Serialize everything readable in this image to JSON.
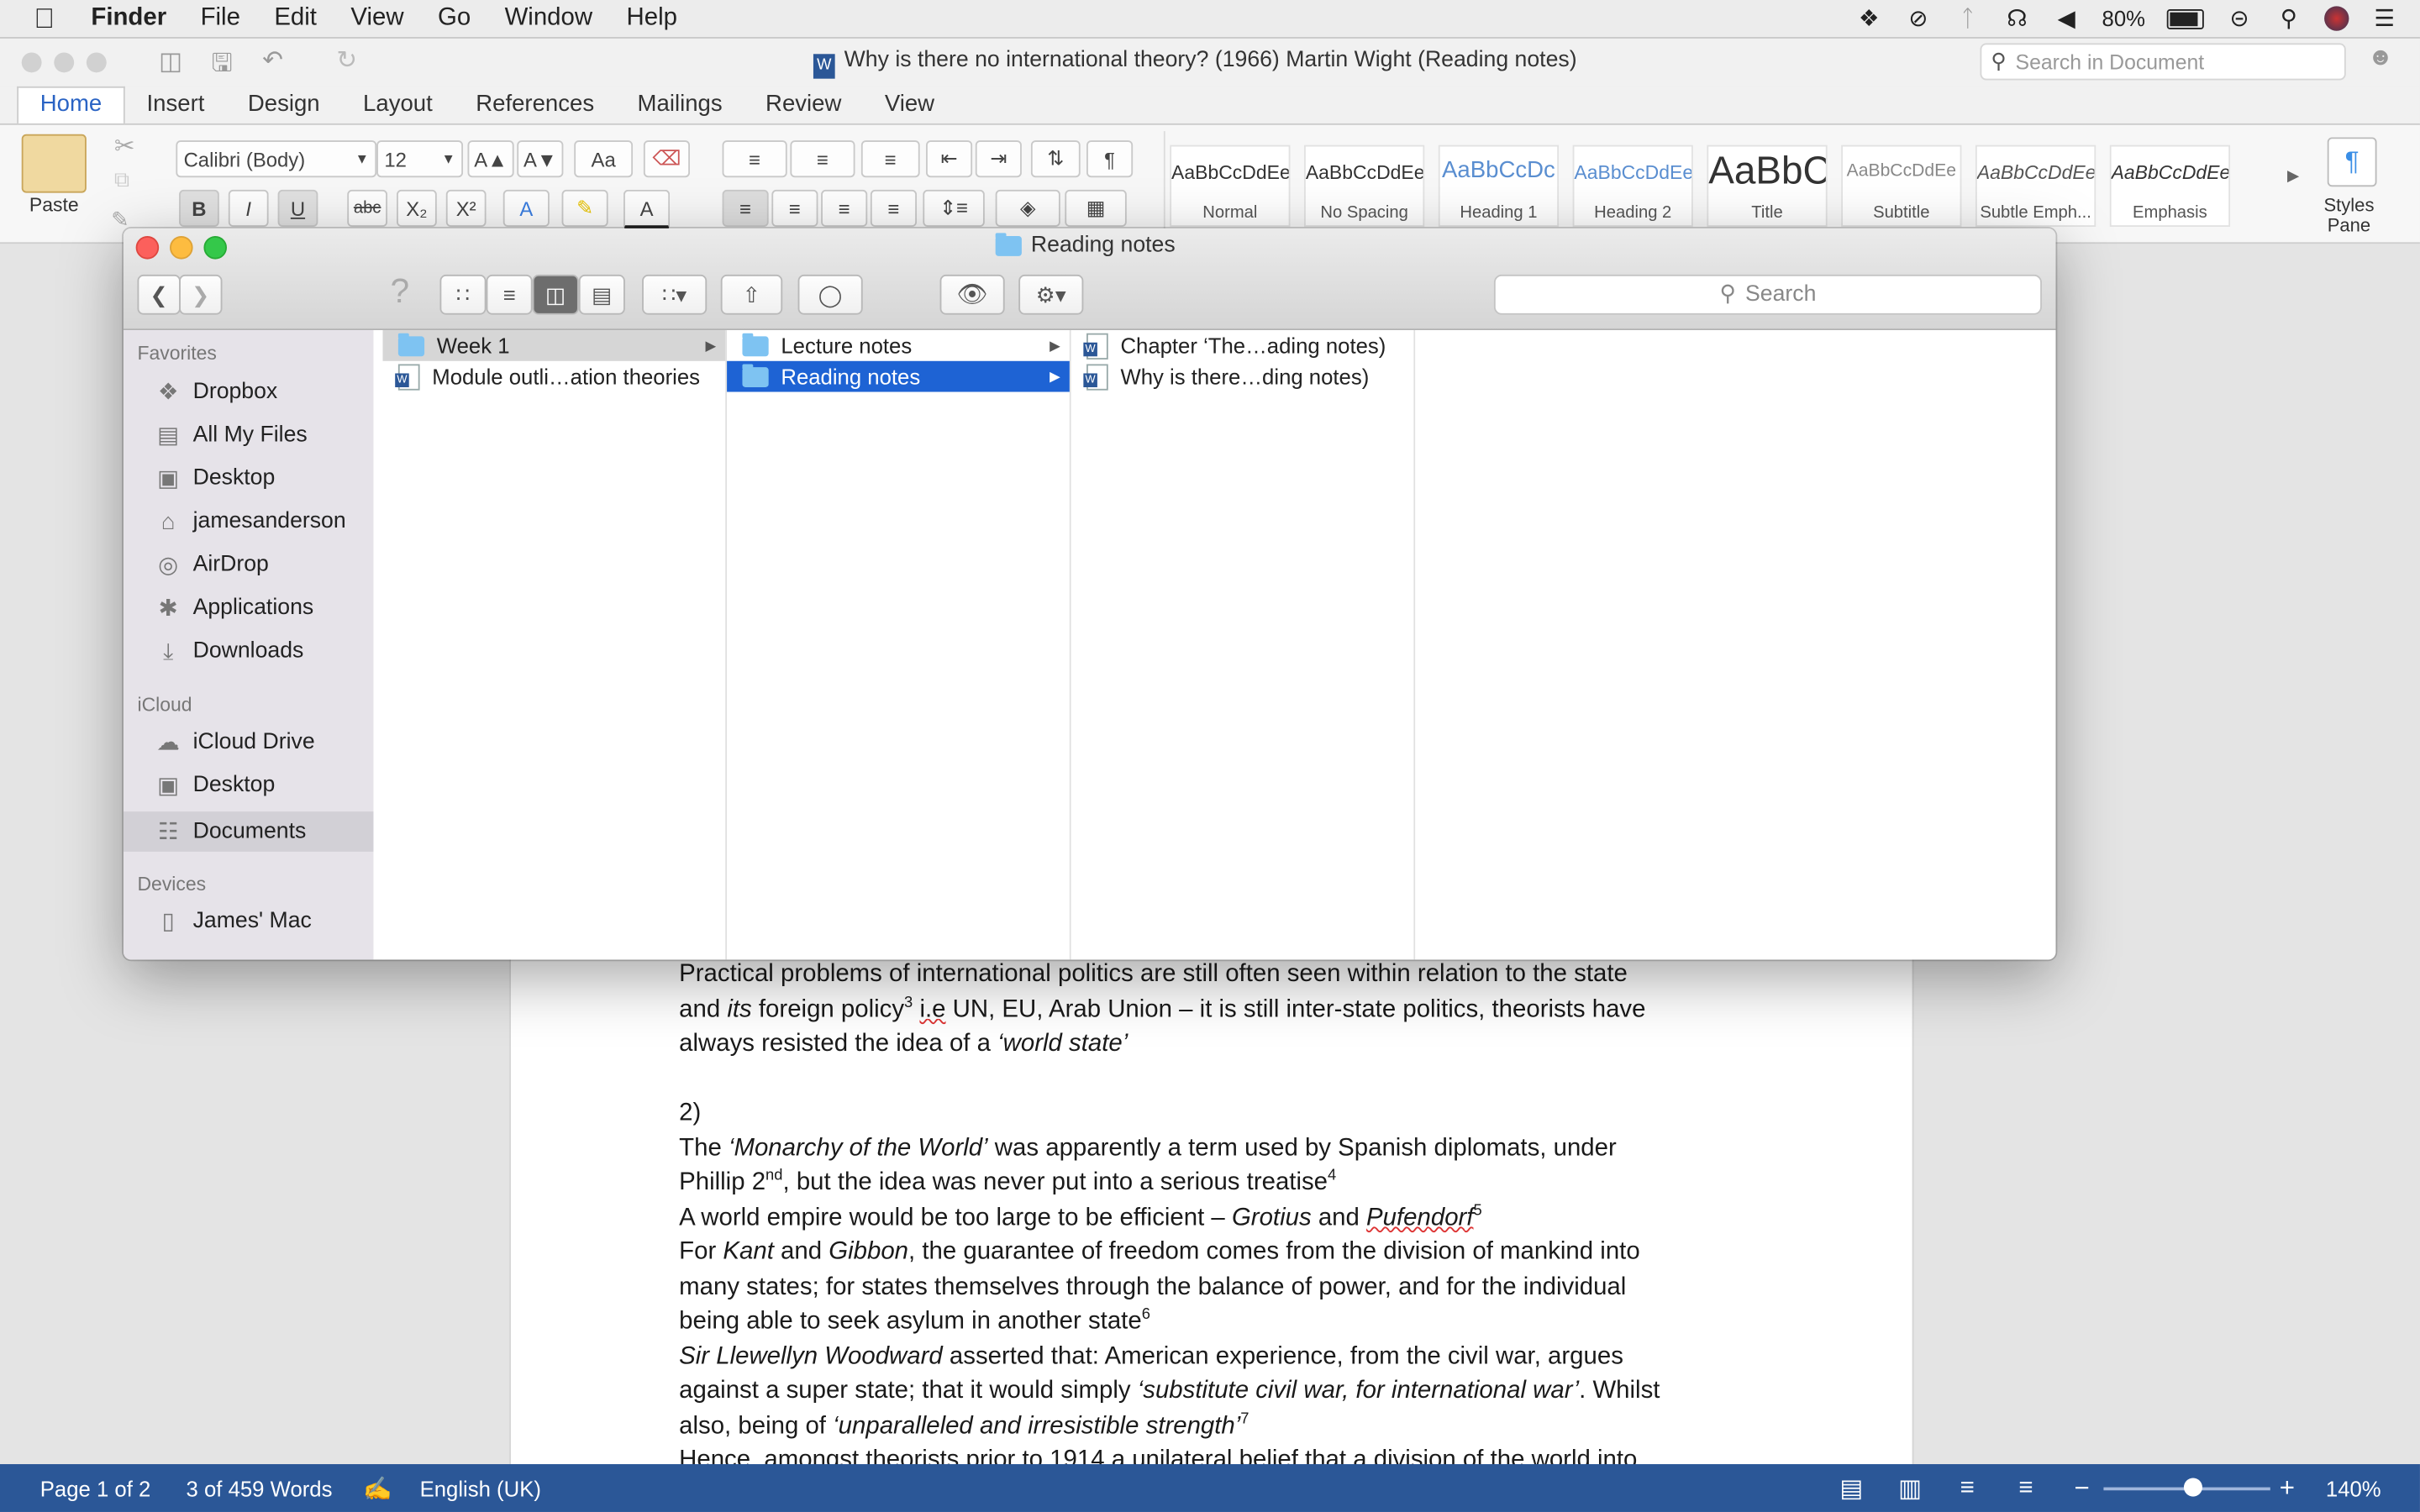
{
  "menubar": {
    "app": "Finder",
    "items": [
      "File",
      "Edit",
      "View",
      "Go",
      "Window",
      "Help"
    ],
    "battery": "80%"
  },
  "word": {
    "title": "Why is there no international theory? (1966) Martin Wight (Reading notes)",
    "search_placeholder": "Search in Document",
    "tabs": [
      "Home",
      "Insert",
      "Design",
      "Layout",
      "References",
      "Mailings",
      "Review",
      "View"
    ],
    "paste_label": "Paste",
    "font_name": "Calibri (Body)",
    "font_size": "12",
    "styles": [
      {
        "sample": "AaBbCcDdEe",
        "name": "Normal"
      },
      {
        "sample": "AaBbCcDdEe",
        "name": "No Spacing"
      },
      {
        "sample": "AaBbCcDc",
        "name": "Heading 1"
      },
      {
        "sample": "AaBbCcDdEe",
        "name": "Heading 2"
      },
      {
        "sample": "AaBbC",
        "name": "Title"
      },
      {
        "sample": "AaBbCcDdEe",
        "name": "Subtitle"
      },
      {
        "sample": "AaBbCcDdEe",
        "name": "Subtle Emph..."
      },
      {
        "sample": "AaBbCcDdEe",
        "name": "Emphasis"
      }
    ],
    "styles_pane_label": "Styles Pane",
    "status": {
      "page": "Page 1 of 2",
      "words": "3 of 459 Words",
      "language": "English (UK)",
      "zoom": "140%"
    }
  },
  "document": {
    "p1a": "Practical problems of international politics are still often seen within relation to the state",
    "p1b_1": "and ",
    "p1b_its": "its",
    "p1b_2": " foreign policy",
    "p1b_sup": "3",
    "p1b_ie": "i.e",
    "p1b_3": " UN, EU, Arab Union – it is still inter-state politics, theorists have",
    "p1c_1": "always resisted the idea of a ",
    "p1c_2": "‘world state’",
    "p2_num": "2)",
    "p3a_1": "The ",
    "p3a_2": "‘Monarchy of the World’",
    "p3a_3": " was apparently a term used by Spanish diplomats, under",
    "p3b_1": "Phillip 2",
    "p3b_sup1": "nd",
    "p3b_2": ", but the idea was never put into a serious treatise",
    "p3b_sup2": "4",
    "p4_1": "A world empire would be too large to be efficient – ",
    "p4_grotius": "Grotius",
    "p4_and": " and ",
    "p4_puf": "Pufendorf",
    "p4_sup": "5",
    "p5a_1": "For ",
    "p5a_kant": "Kant",
    "p5a_and": " and ",
    "p5a_gibbon": "Gibbon",
    "p5a_2": ", the guarantee of freedom comes from the division of mankind into",
    "p5b": "many states; for states themselves through the balance of power, and for the individual",
    "p5c_1": "being able to seek asylum in another state",
    "p5c_sup": "6",
    "p6a_1": "Sir Llewellyn Woodward",
    "p6a_2": " asserted that: American experience, from the civil war, argues",
    "p6b_1": "against a super state; that it would simply ",
    "p6b_2": "‘substitute civil war, for international war’",
    "p6b_3": ". Whilst",
    "p6c_1": "also, being of ",
    "p6c_2": "‘unparalleled and irresistible strength’",
    "p6c_sup": "7",
    "p7": "Hence, amongst theorists prior to 1914 a unilateral belief that a division of the world into"
  },
  "finder": {
    "title": "Reading notes",
    "search_placeholder": "Search",
    "sidebar": {
      "favorites_heading": "Favorites",
      "favorites": [
        {
          "label": "Dropbox",
          "icon": "dropbox-icon"
        },
        {
          "label": "All My Files",
          "icon": "all-files-icon"
        },
        {
          "label": "Desktop",
          "icon": "desktop-icon"
        },
        {
          "label": "jamesanderson",
          "icon": "home-icon"
        },
        {
          "label": "AirDrop",
          "icon": "airdrop-icon"
        },
        {
          "label": "Applications",
          "icon": "applications-icon"
        },
        {
          "label": "Downloads",
          "icon": "downloads-icon"
        }
      ],
      "icloud_heading": "iCloud",
      "icloud": [
        {
          "label": "iCloud Drive",
          "icon": "cloud-icon"
        },
        {
          "label": "Desktop",
          "icon": "desktop-icon"
        },
        {
          "label": "Documents",
          "icon": "documents-icon"
        }
      ],
      "devices_heading": "Devices",
      "devices": [
        {
          "label": "James' Mac",
          "icon": "laptop-icon"
        }
      ]
    },
    "columns": [
      [
        "Week 1",
        "Module outli…ation theories"
      ],
      [
        "Lecture notes",
        "Reading notes"
      ],
      [
        "Chapter ‘The…ading notes)",
        "Why is there…ding notes)"
      ]
    ]
  },
  "colors": {
    "accent_blue": "#1e63d4",
    "word_status_bar": "#2b5797",
    "folder": "#7ec3f2"
  }
}
